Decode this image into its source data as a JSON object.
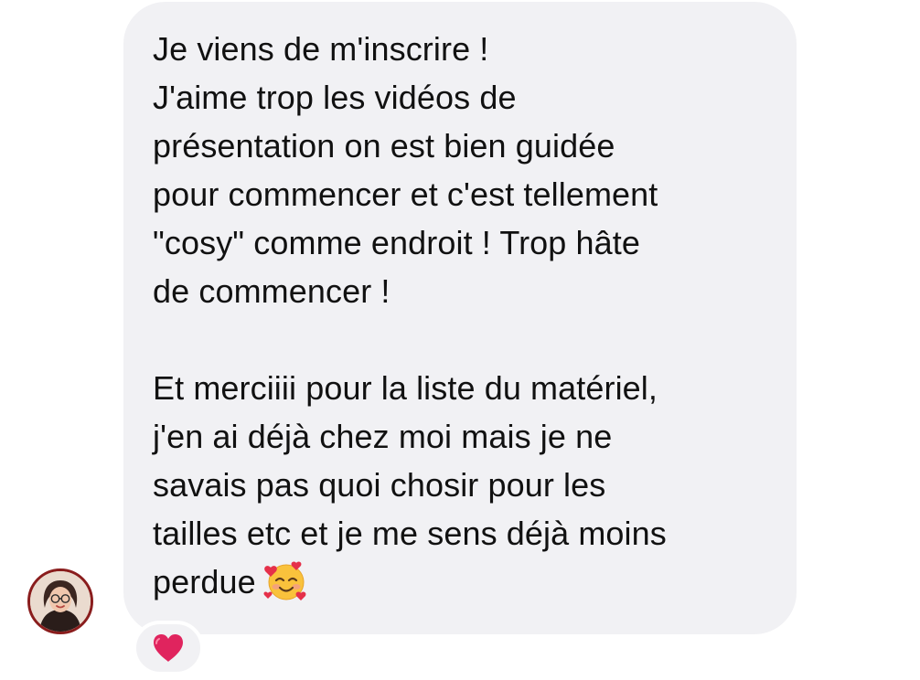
{
  "message": {
    "lines": [
      "Je viens de m'inscrire !",
      "J'aime trop les vidéos de",
      "présentation on est bien guidée",
      "pour commencer et c'est tellement",
      "\"cosy\" comme endroit ! Trop hâte",
      "de commencer !",
      "Et merciiii pour la liste du matériel,",
      "j'en ai déjà chez moi mais je ne",
      "savais pas quoi chosir pour les",
      "tailles etc et je me sens déjà moins",
      "perdue"
    ],
    "emoji_icon": "smiling-face-with-hearts-icon"
  },
  "sender": {
    "avatar_icon": "profile-avatar"
  },
  "reaction": {
    "icon": "red-heart-icon",
    "color": "#e0245e"
  },
  "colors": {
    "bubble": "#f1f1f4",
    "text": "#111111",
    "background": "#ffffff",
    "avatar_ring": "#8a1d1d"
  }
}
